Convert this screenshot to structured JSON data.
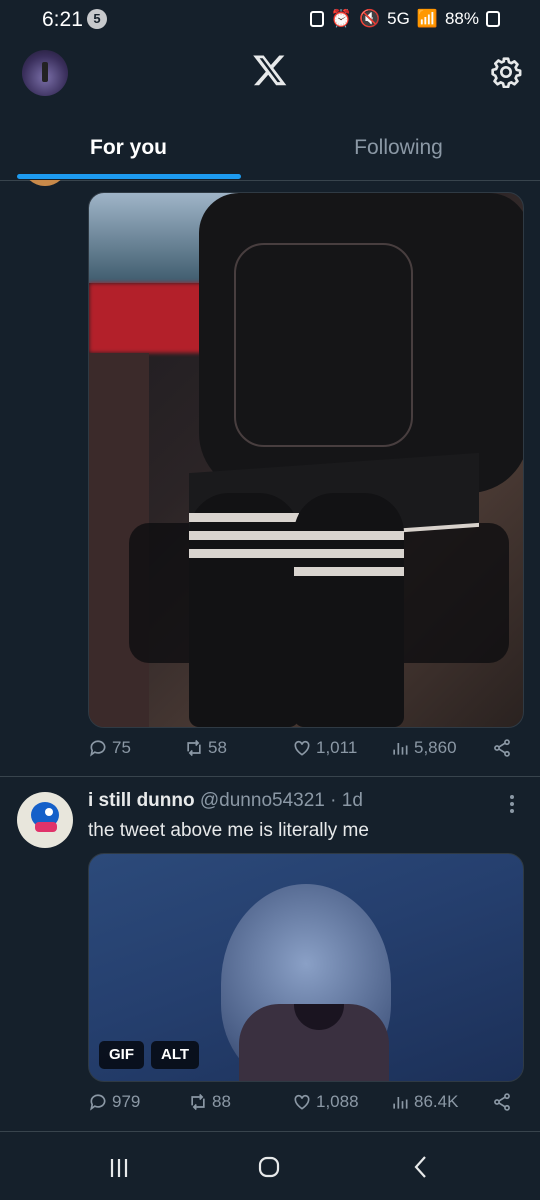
{
  "status_bar": {
    "time": "6:21",
    "notification_count": "5",
    "network": "5G",
    "battery": "88%"
  },
  "header": {
    "logo": "x-logo-icon",
    "settings_icon": "gear-icon"
  },
  "tabs": [
    {
      "label": "For you",
      "active": true
    },
    {
      "label": "Following",
      "active": false
    }
  ],
  "tweets": [
    {
      "media_type": "photo",
      "stats": {
        "replies": "75",
        "retweets": "58",
        "likes": "1,011",
        "views": "5,860"
      }
    },
    {
      "name": "i still dunno",
      "handle": "@dunno54321",
      "time": "· 1d",
      "text": "the tweet above me is literally me",
      "media_badges": {
        "gif": "GIF",
        "alt": "ALT"
      },
      "stats": {
        "replies": "979",
        "retweets": "88",
        "likes": "1,088",
        "views": "86.4K"
      }
    }
  ],
  "colors": {
    "background": "#15202b",
    "accent": "#1d9bf0",
    "muted": "#8b98a5",
    "divider": "#38444d"
  },
  "nav_icons": [
    "recent-apps-icon",
    "home-icon",
    "back-icon"
  ]
}
